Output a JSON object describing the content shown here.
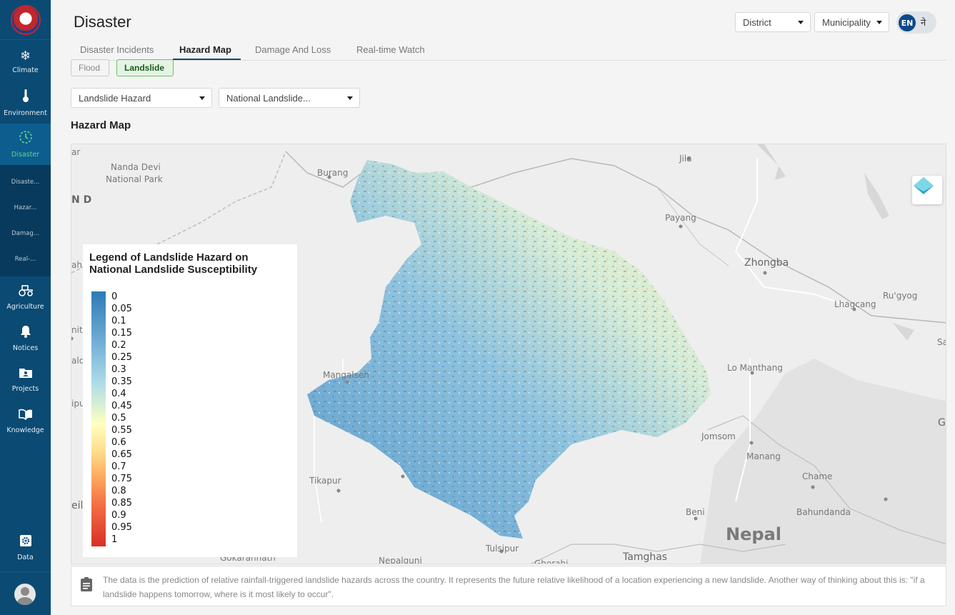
{
  "sidebar": {
    "items": [
      {
        "label": "Climate",
        "icon": "snowflake-icon"
      },
      {
        "label": "Environment",
        "icon": "thermometer-icon"
      },
      {
        "label": "Disaster",
        "icon": "clock-icon"
      },
      {
        "label": "Agriculture",
        "icon": "tractor-icon"
      },
      {
        "label": "Notices",
        "icon": "bell-icon"
      },
      {
        "label": "Projects",
        "icon": "folder-user-icon"
      },
      {
        "label": "Knowledge",
        "icon": "book-icon"
      }
    ],
    "submenu": [
      "Disaste...",
      "Hazar...",
      "Damag...",
      "Real-..."
    ],
    "data_label": "Data"
  },
  "header": {
    "title": "Disaster",
    "district": "District",
    "municipality": "Municipality",
    "lang_en": "EN",
    "lang_ne": "ने"
  },
  "tabs": [
    "Disaster Incidents",
    "Hazard Map",
    "Damage And Loss",
    "Real-time Watch"
  ],
  "hazard_types": [
    "Flood",
    "Landslide"
  ],
  "filters": {
    "layer": "Landslide Hazard",
    "dataset": "National Landslide..."
  },
  "section_title": "Hazard Map",
  "map": {
    "places": [
      "ar",
      "Nanda Devi",
      "National Park",
      "Burang",
      "Jila",
      "N D",
      "Payang",
      "Zhongba",
      "Ru'gyog",
      "Lhagcang",
      "ah",
      "nit",
      "Sa",
      "ald",
      "Mangalsen",
      "Lo Manthang",
      "ipu",
      "G",
      "Jomsom",
      "Manang",
      "Chame",
      "Tikapur",
      "Beni",
      "Bahundanda",
      "eill",
      "Nepal",
      "Gokarannath",
      "Tulsipur",
      "Nepalgunj",
      "Tamghas",
      "Ghorahi"
    ]
  },
  "legend": {
    "title": "Legend of Landslide Hazard on National Landslide Susceptibility",
    "labels": [
      "0",
      "0.05",
      "0.1",
      "0.15",
      "0.2",
      "0.25",
      "0.3",
      "0.35",
      "0.4",
      "0.45",
      "0.5",
      "0.55",
      "0.6",
      "0.65",
      "0.7",
      "0.75",
      "0.8",
      "0.85",
      "0.9",
      "0.95",
      "1"
    ]
  },
  "info": {
    "text": "The data is the prediction of relative rainfall-triggered landslide hazards across the country. It represents the future relative likelihood of a location experiencing a new landslide. Another way of thinking about this is: \"if a landslide happens tomorrow, where is it most likely to occur\"."
  },
  "colors": {
    "sidebar": "#0a4a73",
    "active_nav": "#5fd88a",
    "hazard_low": "#2c7bb6",
    "hazard_mid": "#ffffbf",
    "hazard_high": "#d73027"
  }
}
